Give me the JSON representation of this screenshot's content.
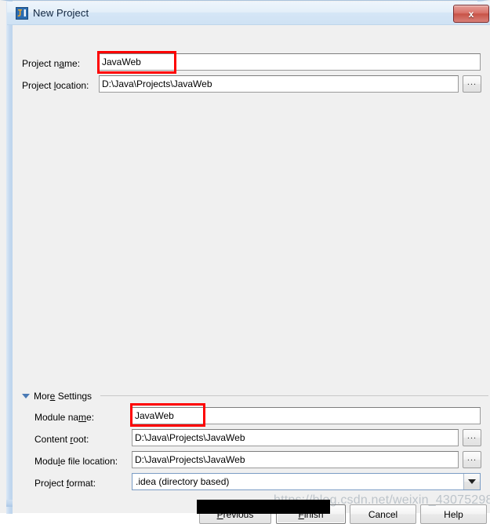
{
  "window": {
    "title": "New Project",
    "icon": "intellij-idea-icon",
    "close_label": "x",
    "accent_border": "#bdd4ec",
    "background": "#f0f0f0"
  },
  "fields": {
    "project_name": {
      "label_before": "Project n",
      "label_mnemonic": "a",
      "label_after": "me:",
      "value": "JavaWeb",
      "highlighted": true
    },
    "project_location": {
      "label_before": "Project ",
      "label_mnemonic": "l",
      "label_after": "ocation:",
      "value": "D:\\Java\\Projects\\JavaWeb",
      "browse_label": "..."
    }
  },
  "more_settings": {
    "label": "More Settings",
    "label_before": "Mor",
    "label_mnemonic": "e",
    "label_after": " Settings",
    "expanded": true,
    "triangle_color": "#4a7ab5",
    "fields": {
      "module_name": {
        "label_before": "Module na",
        "label_mnemonic": "m",
        "label_after": "e:",
        "value": "JavaWeb",
        "highlighted": true
      },
      "content_root": {
        "label_before": "Content ",
        "label_mnemonic": "r",
        "label_after": "oot:",
        "value": "D:\\Java\\Projects\\JavaWeb",
        "browse_label": "..."
      },
      "module_file_location": {
        "label_before": "Modu",
        "label_mnemonic": "l",
        "label_after": "e file location:",
        "value": "D:\\Java\\Projects\\JavaWeb",
        "browse_label": "..."
      },
      "project_format": {
        "label_before": "Project ",
        "label_mnemonic": "f",
        "label_after": "ormat:",
        "value": ".idea (directory based)"
      }
    }
  },
  "buttons": {
    "previous": {
      "before": "",
      "mnemonic": "P",
      "after": "revious"
    },
    "finish": {
      "before": "",
      "mnemonic": "F",
      "after": "inish",
      "is_default": true
    },
    "cancel": {
      "before": "Cancel",
      "mnemonic": "",
      "after": ""
    },
    "help": {
      "before": "Help",
      "mnemonic": "",
      "after": ""
    }
  },
  "annotations": {
    "highlight_color": "#fe0000",
    "watermark": "https://blog.csdn.net/weixin_43075298"
  }
}
